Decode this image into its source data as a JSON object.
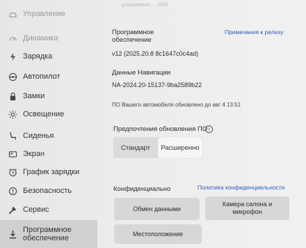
{
  "sidebar": {
    "items": [
      {
        "label": "Управление",
        "icon": "car-icon",
        "state": "faded"
      },
      {
        "label": "Динамика",
        "icon": "speedometer-icon",
        "state": "faded"
      },
      {
        "label": "Зарядка",
        "icon": "bolt-icon",
        "state": "normal"
      },
      {
        "label": "Автопилот",
        "icon": "steering-wheel-icon",
        "state": "normal"
      },
      {
        "label": "Замки",
        "icon": "lock-icon",
        "state": "normal"
      },
      {
        "label": "Освещение",
        "icon": "sun-icon",
        "state": "normal"
      },
      {
        "label": "Сиденья",
        "icon": "seat-icon",
        "state": "normal"
      },
      {
        "label": "Экран",
        "icon": "display-icon",
        "state": "normal"
      },
      {
        "label": "График зарядки",
        "icon": "alarm-clock-icon",
        "state": "normal"
      },
      {
        "label": "Безопасность",
        "icon": "safety-icon",
        "state": "normal"
      },
      {
        "label": "Сервис",
        "icon": "wrench-icon",
        "state": "normal"
      },
      {
        "label": "Программное\nобеспечение",
        "icon": "download-icon",
        "state": "active"
      }
    ]
  },
  "software": {
    "top_faded_text": "установлено ... 2026",
    "section_title": "Программное\nобеспечение",
    "release_notes_link": "Примечания к релизу",
    "version": "v12 (2025.20.8 8c1647c0c4ad)",
    "nav_data_title": "Данные Навигации",
    "nav_data_value": "NA-2024.20-15137-9ba2589b22",
    "update_status": "ПО Вашего автомобиля обновлено до авг 4 13:51"
  },
  "update_prefs": {
    "title": "Предпочтения обновления ПО",
    "info_icon": "info-icon",
    "options": [
      "Стандарт",
      "Расширенно"
    ],
    "selected": "Расширенно"
  },
  "privacy": {
    "title": "Конфиденциально",
    "policy_link": "Политика конфиденциальности",
    "buttons": [
      "Обмен данными",
      "Камера салона и\nмикрофон",
      "Местоположение"
    ]
  }
}
